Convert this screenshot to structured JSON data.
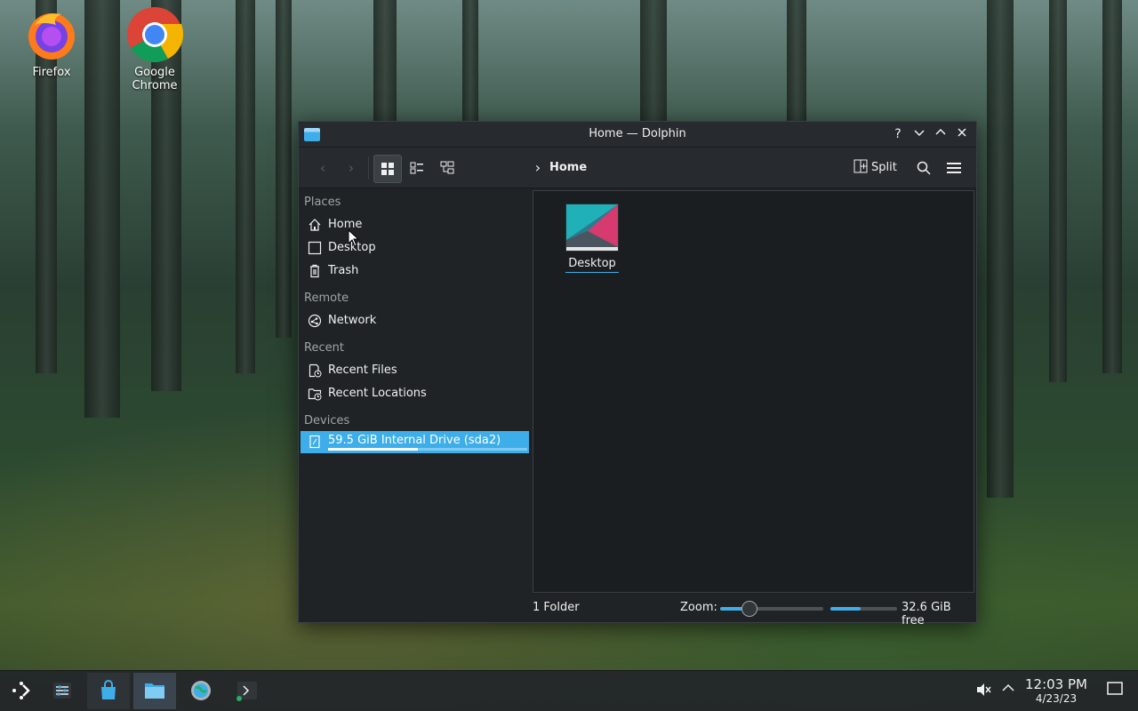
{
  "desktop": {
    "icons": [
      {
        "label": "Firefox"
      },
      {
        "label": "Google Chrome"
      }
    ]
  },
  "window": {
    "title": "Home — Dolphin",
    "controls": {
      "help": "?",
      "minimize": "⌄",
      "maximize": "⌃",
      "close": "✕"
    },
    "toolbar": {
      "back": "‹",
      "forward": "›",
      "breadcrumb_chevron": "›",
      "breadcrumb": "Home",
      "split_label": "Split"
    },
    "sidebar": {
      "sections": [
        {
          "heading": "Places",
          "items": [
            {
              "label": "Home",
              "icon": "home-icon"
            },
            {
              "label": "Desktop",
              "icon": "desktop-icon"
            },
            {
              "label": "Trash",
              "icon": "trash-icon"
            }
          ]
        },
        {
          "heading": "Remote",
          "items": [
            {
              "label": "Network",
              "icon": "network-icon"
            }
          ]
        },
        {
          "heading": "Recent",
          "items": [
            {
              "label": "Recent Files",
              "icon": "recent-files-icon"
            },
            {
              "label": "Recent Locations",
              "icon": "recent-locations-icon"
            }
          ]
        },
        {
          "heading": "Devices",
          "items": [
            {
              "label": "59.5 GiB Internal Drive (sda2)",
              "icon": "drive-icon",
              "selected": true,
              "usage_fraction": 0.45
            }
          ]
        }
      ]
    },
    "content": {
      "items": [
        {
          "name": "Desktop"
        }
      ]
    },
    "status": {
      "count": "1 Folder",
      "zoom_label": "Zoom:",
      "zoom_fraction": 0.28,
      "free_fraction": 0.45,
      "free_space": "32.6 GiB free"
    }
  },
  "taskbar": {
    "clock_time": "12:03 PM",
    "clock_date": "4/23/23"
  },
  "colors": {
    "accent": "#3daee9",
    "window_bg": "#202326",
    "view_bg": "#1b1e20"
  }
}
